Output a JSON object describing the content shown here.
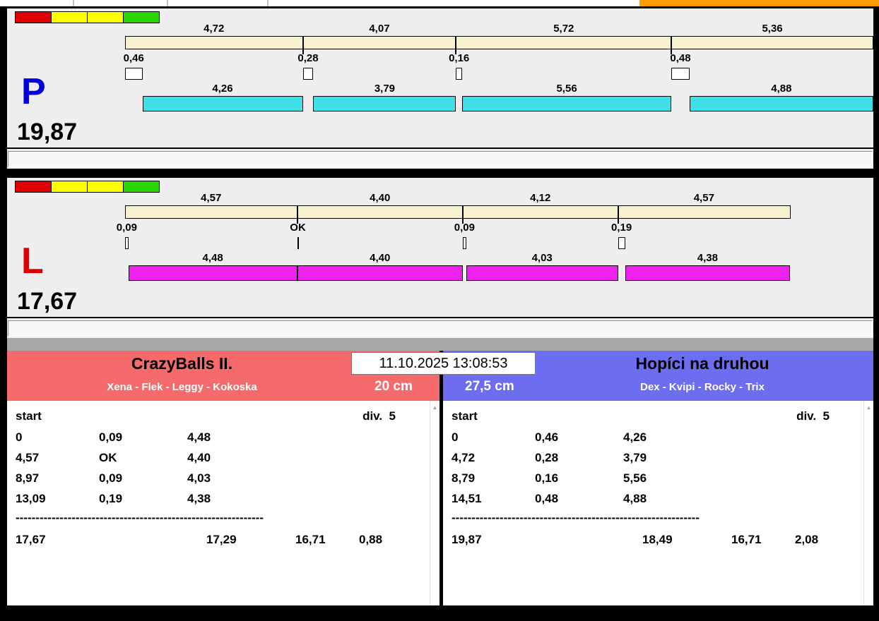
{
  "top_strip": {
    "accent_color": "#ff9d00"
  },
  "timestamp": "11.10.2025 13:08:53",
  "lanes": [
    {
      "letter": "P",
      "letter_color": "#0000dd",
      "bar_color": "#3fdfe8",
      "total": "19,87",
      "total_sec": 19.87,
      "flags": [
        "#e10000",
        "#ffff00",
        "#ffff00",
        "#2bd500"
      ],
      "legs": [
        {
          "split": "4,72",
          "split_sec": 4.72,
          "loss": "0,46",
          "loss_sec": 0.46,
          "run": "4,26",
          "run_sec": 4.26
        },
        {
          "split": "4,07",
          "split_sec": 4.07,
          "loss": "0,28",
          "loss_sec": 0.28,
          "run": "3,79",
          "run_sec": 3.79
        },
        {
          "split": "5,72",
          "split_sec": 5.72,
          "loss": "0,16",
          "loss_sec": 0.16,
          "run": "5,56",
          "run_sec": 5.56
        },
        {
          "split": "5,36",
          "split_sec": 5.36,
          "loss": "0,48",
          "loss_sec": 0.48,
          "run": "4,88",
          "run_sec": 4.88
        }
      ]
    },
    {
      "letter": "L",
      "letter_color": "#dd0000",
      "bar_color": "#ee22ee",
      "total": "17,67",
      "total_sec": 17.67,
      "flags": [
        "#e10000",
        "#ffff00",
        "#ffff00",
        "#2bd500"
      ],
      "legs": [
        {
          "split": "4,57",
          "split_sec": 4.57,
          "loss": "0,09",
          "loss_sec": 0.09,
          "run": "4,48",
          "run_sec": 4.48
        },
        {
          "split": "4,40",
          "split_sec": 4.4,
          "loss": "OK",
          "loss_sec": 0,
          "run": "4,40",
          "run_sec": 4.4
        },
        {
          "split": "4,12",
          "split_sec": 4.12,
          "loss": "0,09",
          "loss_sec": 0.09,
          "run": "4,03",
          "run_sec": 4.03
        },
        {
          "split": "4,57",
          "split_sec": 4.57,
          "loss": "0,19",
          "loss_sec": 0.19,
          "run": "4,38",
          "run_sec": 4.38
        }
      ]
    }
  ],
  "teams": [
    {
      "name": "CrazyBalls II.",
      "members": "Xena - Flek - Leggy - Kokoska",
      "height_label": "20 cm",
      "header_color": "#f56b6b",
      "table": {
        "start_label": "start",
        "div_label": "div.  5",
        "rows": [
          {
            "time": "0",
            "loss": "0,09",
            "run": "4,48"
          },
          {
            "time": "4,57",
            "loss": "OK",
            "run": "4,40"
          },
          {
            "time": "8,97",
            "loss": "0,09",
            "run": "4,03"
          },
          {
            "time": "13,09",
            "loss": "0,19",
            "run": "4,38"
          }
        ],
        "separator": "--------------------------------------------------------------",
        "total": "17,67",
        "sum_runs": "17,29",
        "best": "16,71",
        "diff": "0,88"
      }
    },
    {
      "name": "Hopíci na druhou",
      "members": "Dex - Kvipi - Rocky - Trix",
      "height_label": "27,5 cm",
      "header_color": "#6d6df2",
      "table": {
        "start_label": "start",
        "div_label": "div.  5",
        "rows": [
          {
            "time": "0",
            "loss": "0,46",
            "run": "4,26"
          },
          {
            "time": "4,72",
            "loss": "0,28",
            "run": "3,79"
          },
          {
            "time": "8,79",
            "loss": "0,16",
            "run": "5,56"
          },
          {
            "time": "14,51",
            "loss": "0,48",
            "run": "4,88"
          }
        ],
        "separator": "--------------------------------------------------------------",
        "total": "19,87",
        "sum_runs": "18,49",
        "best": "16,71",
        "diff": "2,08"
      }
    }
  ]
}
